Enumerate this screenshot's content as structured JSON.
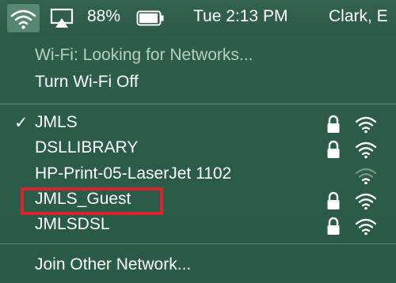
{
  "menubar": {
    "battery_percent": "88%",
    "datetime": "Tue 2:13 PM",
    "user": "Clark, E"
  },
  "menu": {
    "status": "Wi-Fi: Looking for Networks...",
    "toggle_label": "Turn Wi-Fi Off",
    "check_mark": "✓",
    "networks": [
      {
        "name": "JMLS",
        "selected": true,
        "locked": true,
        "signal": "strong"
      },
      {
        "name": "DSLLIBRARY",
        "selected": false,
        "locked": true,
        "signal": "strong"
      },
      {
        "name": "HP-Print-05-LaserJet 1102",
        "selected": false,
        "locked": false,
        "signal": "weak"
      },
      {
        "name": "JMLS_Guest",
        "selected": false,
        "locked": true,
        "signal": "strong"
      },
      {
        "name": "JMLSDSL",
        "selected": false,
        "locked": true,
        "signal": "strong"
      }
    ],
    "join_other": "Join Other Network..."
  },
  "colors": {
    "menu_bg": "#2c5a4a",
    "annotation": "#d9232d",
    "dim_text": "#b7cdc4"
  },
  "icons": [
    "wifi-icon",
    "airplay-icon",
    "battery-icon",
    "lock-icon",
    "wifi-signal-icon"
  ]
}
